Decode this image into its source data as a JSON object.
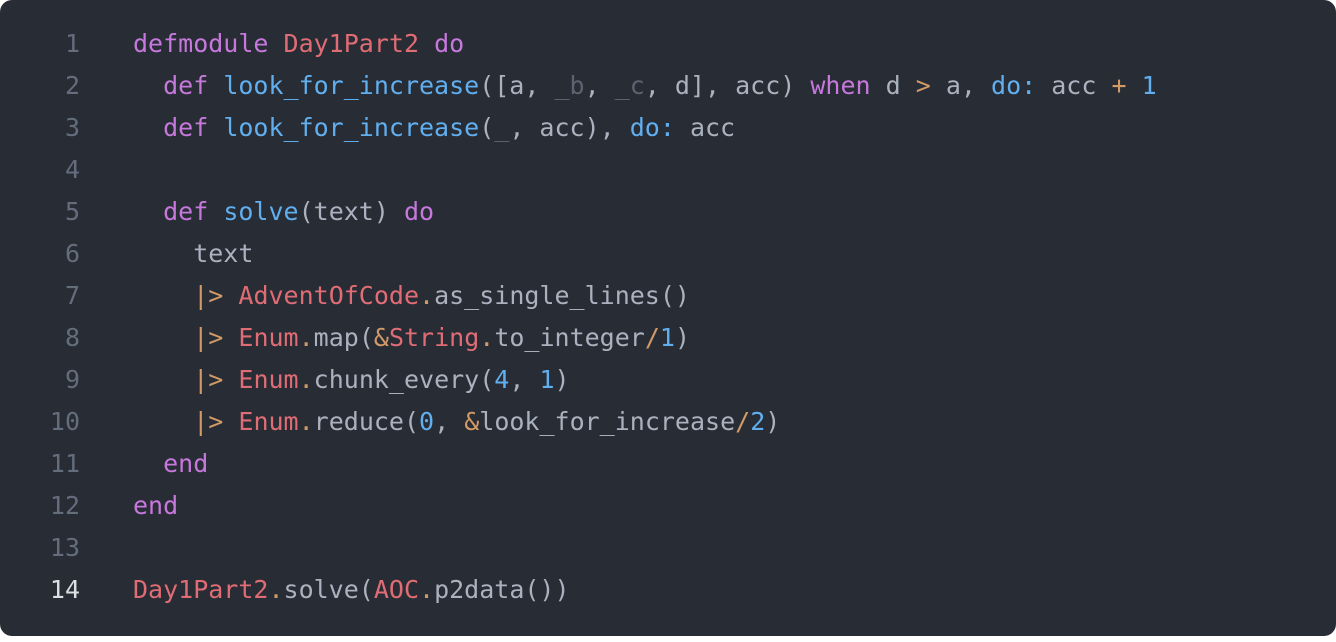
{
  "editor": {
    "current_line": 14,
    "theme": {
      "background": "#282c34",
      "line_number": "#636d7c",
      "line_number_active": "#dcdfe4",
      "keyword": "#c678dd",
      "module": "#e06c75",
      "function": "#61afef",
      "operator": "#d19a66",
      "number": "#61afef",
      "atom": "#61afef",
      "unused": "#5c6370",
      "text": "#abb2bf"
    },
    "lines": [
      {
        "number": "1",
        "tokens": [
          {
            "t": "defmodule",
            "k": "kw"
          },
          {
            "t": " ",
            "k": "plain"
          },
          {
            "t": "Day1Part2",
            "k": "mod"
          },
          {
            "t": " ",
            "k": "plain"
          },
          {
            "t": "do",
            "k": "kw"
          }
        ]
      },
      {
        "number": "2",
        "tokens": [
          {
            "t": "  ",
            "k": "plain"
          },
          {
            "t": "def",
            "k": "kw"
          },
          {
            "t": " ",
            "k": "plain"
          },
          {
            "t": "look_for_increase",
            "k": "fn"
          },
          {
            "t": "([a, ",
            "k": "plain"
          },
          {
            "t": "_b",
            "k": "unused"
          },
          {
            "t": ", ",
            "k": "plain"
          },
          {
            "t": "_c",
            "k": "unused"
          },
          {
            "t": ", d], acc) ",
            "k": "plain"
          },
          {
            "t": "when",
            "k": "kw"
          },
          {
            "t": " d ",
            "k": "plain"
          },
          {
            "t": ">",
            "k": "op"
          },
          {
            "t": " a, ",
            "k": "plain"
          },
          {
            "t": "do:",
            "k": "atom"
          },
          {
            "t": " acc ",
            "k": "plain"
          },
          {
            "t": "+",
            "k": "op"
          },
          {
            "t": " ",
            "k": "plain"
          },
          {
            "t": "1",
            "k": "num"
          }
        ]
      },
      {
        "number": "3",
        "tokens": [
          {
            "t": "  ",
            "k": "plain"
          },
          {
            "t": "def",
            "k": "kw"
          },
          {
            "t": " ",
            "k": "plain"
          },
          {
            "t": "look_for_increase",
            "k": "fn"
          },
          {
            "t": "(",
            "k": "plain"
          },
          {
            "t": "_",
            "k": "unused"
          },
          {
            "t": ", acc), ",
            "k": "plain"
          },
          {
            "t": "do:",
            "k": "atom"
          },
          {
            "t": " acc",
            "k": "plain"
          }
        ]
      },
      {
        "number": "4",
        "tokens": []
      },
      {
        "number": "5",
        "tokens": [
          {
            "t": "  ",
            "k": "plain"
          },
          {
            "t": "def",
            "k": "kw"
          },
          {
            "t": " ",
            "k": "plain"
          },
          {
            "t": "solve",
            "k": "fn"
          },
          {
            "t": "(text) ",
            "k": "plain"
          },
          {
            "t": "do",
            "k": "kw"
          }
        ]
      },
      {
        "number": "6",
        "tokens": [
          {
            "t": "    text",
            "k": "plain"
          }
        ]
      },
      {
        "number": "7",
        "tokens": [
          {
            "t": "    ",
            "k": "plain"
          },
          {
            "t": "|>",
            "k": "op"
          },
          {
            "t": " ",
            "k": "plain"
          },
          {
            "t": "AdventOfCode",
            "k": "mod"
          },
          {
            "t": ".",
            "k": "op"
          },
          {
            "t": "as_single_lines()",
            "k": "plain"
          }
        ]
      },
      {
        "number": "8",
        "tokens": [
          {
            "t": "    ",
            "k": "plain"
          },
          {
            "t": "|>",
            "k": "op"
          },
          {
            "t": " ",
            "k": "plain"
          },
          {
            "t": "Enum",
            "k": "mod"
          },
          {
            "t": ".",
            "k": "op"
          },
          {
            "t": "map(",
            "k": "plain"
          },
          {
            "t": "&",
            "k": "op"
          },
          {
            "t": "String",
            "k": "mod"
          },
          {
            "t": ".",
            "k": "op"
          },
          {
            "t": "to_integer",
            "k": "plain"
          },
          {
            "t": "/",
            "k": "op"
          },
          {
            "t": "1",
            "k": "num"
          },
          {
            "t": ")",
            "k": "plain"
          }
        ]
      },
      {
        "number": "9",
        "tokens": [
          {
            "t": "    ",
            "k": "plain"
          },
          {
            "t": "|>",
            "k": "op"
          },
          {
            "t": " ",
            "k": "plain"
          },
          {
            "t": "Enum",
            "k": "mod"
          },
          {
            "t": ".",
            "k": "op"
          },
          {
            "t": "chunk_every(",
            "k": "plain"
          },
          {
            "t": "4",
            "k": "num"
          },
          {
            "t": ", ",
            "k": "plain"
          },
          {
            "t": "1",
            "k": "num"
          },
          {
            "t": ")",
            "k": "plain"
          }
        ]
      },
      {
        "number": "10",
        "tokens": [
          {
            "t": "    ",
            "k": "plain"
          },
          {
            "t": "|>",
            "k": "op"
          },
          {
            "t": " ",
            "k": "plain"
          },
          {
            "t": "Enum",
            "k": "mod"
          },
          {
            "t": ".",
            "k": "op"
          },
          {
            "t": "reduce(",
            "k": "plain"
          },
          {
            "t": "0",
            "k": "num"
          },
          {
            "t": ", ",
            "k": "plain"
          },
          {
            "t": "&",
            "k": "op"
          },
          {
            "t": "look_for_increase",
            "k": "plain"
          },
          {
            "t": "/",
            "k": "op"
          },
          {
            "t": "2",
            "k": "num"
          },
          {
            "t": ")",
            "k": "plain"
          }
        ]
      },
      {
        "number": "11",
        "tokens": [
          {
            "t": "  ",
            "k": "plain"
          },
          {
            "t": "end",
            "k": "kw"
          }
        ]
      },
      {
        "number": "12",
        "tokens": [
          {
            "t": "end",
            "k": "kw"
          }
        ]
      },
      {
        "number": "13",
        "tokens": []
      },
      {
        "number": "14",
        "tokens": [
          {
            "t": "Day1Part2",
            "k": "mod"
          },
          {
            "t": ".",
            "k": "op"
          },
          {
            "t": "solve(",
            "k": "plain"
          },
          {
            "t": "AOC",
            "k": "mod"
          },
          {
            "t": ".",
            "k": "op"
          },
          {
            "t": "p2data())",
            "k": "plain"
          }
        ]
      }
    ]
  }
}
